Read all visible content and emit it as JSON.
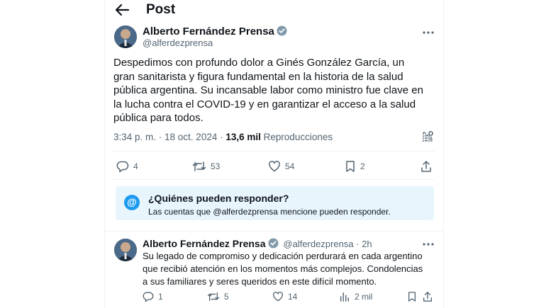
{
  "header": {
    "title": "Post"
  },
  "tweet": {
    "author_name": "Alberto Fernández Prensa",
    "handle": "@alferdezprensa",
    "text": "Despedimos con profundo dolor a Ginés González García, un gran sanitarista y figura fundamental en la historia de la salud pública argentina. Su incansable labor como ministro fue clave en la lucha contra el COVID-19 y en garantizar el acceso a la salud pública para todos.",
    "time": "3:34 p. m. · 18 oct. 2024 · ",
    "views_count": "13,6 mil",
    "views_label": " Reproducciones",
    "stats": {
      "replies": "4",
      "retweets": "53",
      "likes": "54",
      "bookmarks": "2"
    }
  },
  "reply_restriction": {
    "title": "¿Quiénes pueden responder?",
    "subtitle": "Las cuentas que @alferdezprensa mencione pueden responder."
  },
  "reply": {
    "author_name": "Alberto Fernández Prensa",
    "handle_time": "@alferdezprensa · 2h",
    "text": "Su legado de compromiso y dedicación perdurará en cada argentino que recibió atención en los momentos más complejos.  Condolencias a sus familiares y seres queridos en este difícil momento.",
    "stats": {
      "replies": "1",
      "retweets": "5",
      "likes": "14",
      "views": "2 mil"
    }
  },
  "colors": {
    "verified": "#1d9bf0",
    "muted": "#536471",
    "reply_box_bg": "#e8f5fd"
  }
}
